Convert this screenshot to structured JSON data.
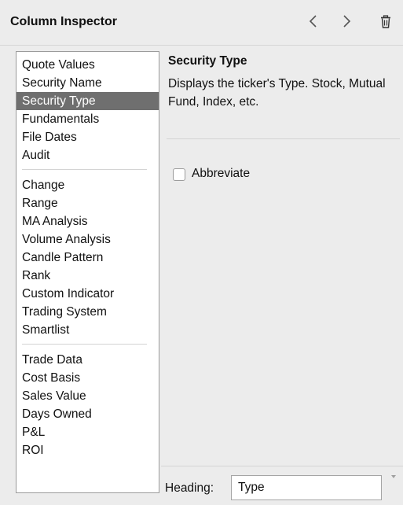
{
  "header": {
    "title": "Column Inspector",
    "back_icon": "chevron-left-icon",
    "forward_icon": "chevron-right-icon",
    "delete_icon": "trash-icon"
  },
  "list": {
    "groups": [
      [
        "Quote Values",
        "Security Name",
        "Security Type",
        "Fundamentals",
        "File Dates",
        "Audit"
      ],
      [
        "Change",
        "Range",
        "MA Analysis",
        "Volume Analysis",
        "Candle Pattern",
        "Rank",
        "Custom Indicator",
        "Trading System",
        "Smartlist"
      ],
      [
        "Trade Data",
        "Cost Basis",
        "Sales Value",
        "Days Owned",
        "P&L",
        "ROI"
      ]
    ],
    "selected": "Security Type",
    "selected_color": "#6f6f6f"
  },
  "detail": {
    "title": "Security Type",
    "description": "Displays the ticker's Type.  Stock, Mutual Fund, Index, etc.",
    "abbreviate_label": "Abbreviate",
    "abbreviate_checked": false
  },
  "footer": {
    "heading_label": "Heading:",
    "heading_value": "Type"
  }
}
